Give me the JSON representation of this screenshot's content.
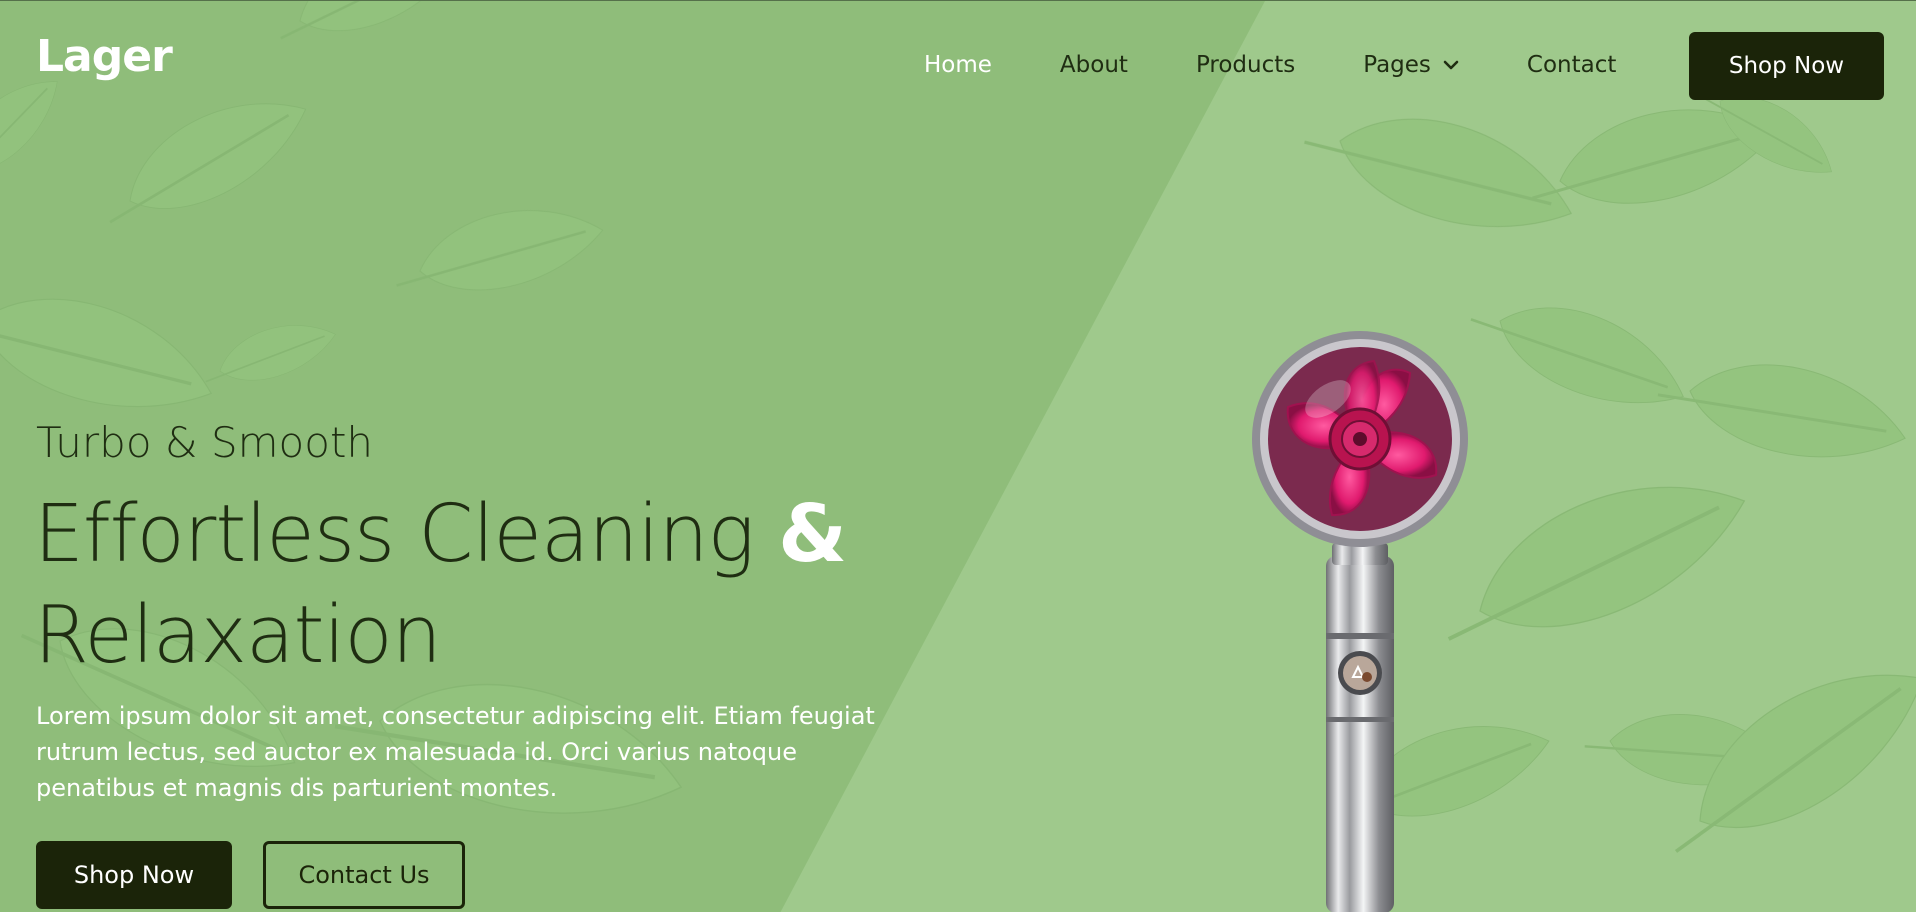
{
  "brand": {
    "logo_text": "Lager"
  },
  "nav": {
    "items": [
      {
        "label": "Home",
        "active": true
      },
      {
        "label": "About",
        "active": false
      },
      {
        "label": "Products",
        "active": false
      },
      {
        "label": "Pages",
        "active": false,
        "has_dropdown": true,
        "icon": "chevron-down-icon"
      },
      {
        "label": "Contact",
        "active": false
      }
    ],
    "cta_label": "Shop Now"
  },
  "hero": {
    "subtitle": "Turbo & Smooth",
    "headline_line1": "Effortless Cleaning",
    "headline_amp": "&",
    "headline_line2": "Relaxation",
    "body": "Lorem ipsum dolor sit amet, consectetur adipiscing elit. Etiam feugiat rutrum lectus, sed auctor ex malesuada id. Orci varius natoque penatibus et magnis dis parturient montes.",
    "primary_button": "Shop Now",
    "secondary_button": "Contact Us"
  },
  "colors": {
    "background": "#8fbd7a",
    "dark": "#1b2409",
    "text_dark": "#1f2d12",
    "light": "#ffffff",
    "accent_pink": "#e01a6e"
  }
}
